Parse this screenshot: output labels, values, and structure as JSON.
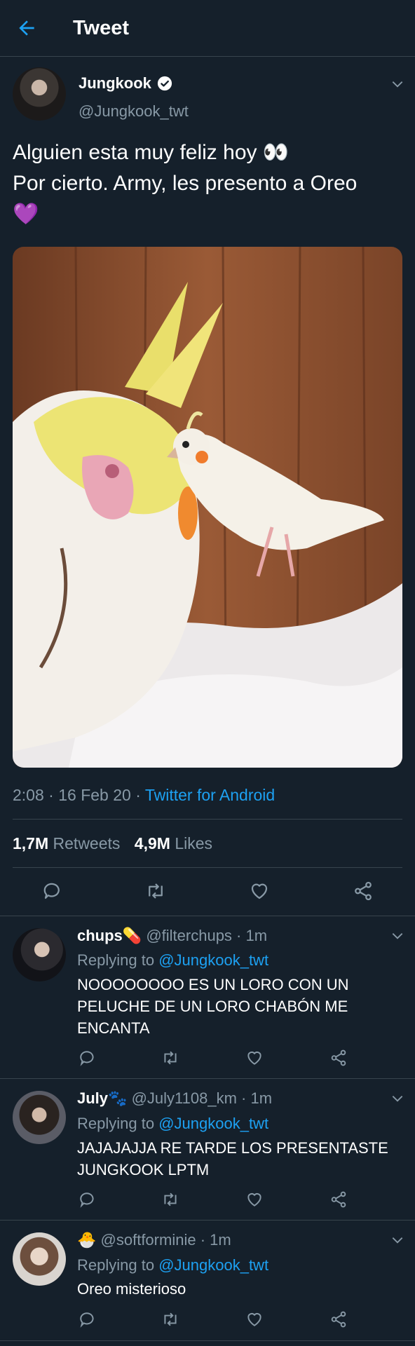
{
  "header": {
    "title": "Tweet"
  },
  "tweet": {
    "author_name": "Jungkook",
    "author_handle": "@Jungkook_twt",
    "text_line1": "Alguien esta muy feliz hoy 👀",
    "text_line2": "Por cierto. Army, les presento a Oreo",
    "text_line3": "💜",
    "time": "2:08",
    "date": "16 Feb 20",
    "source": "Twitter for Android",
    "retweets_count": "1,7M",
    "retweets_label": "Retweets",
    "likes_count": "4,9M",
    "likes_label": "Likes"
  },
  "replies": [
    {
      "name": "chups",
      "emoji": "💊",
      "handle": "@filterchups",
      "time": "1m",
      "replying_label": "Replying to",
      "replying_to": "@Jungkook_twt",
      "text_line1": "NOOOOOOOO ES UN LORO CON UN",
      "text_line2": "PELUCHE DE UN LORO CHABÓN ME",
      "text_line3": "ENCANTA"
    },
    {
      "name": "July",
      "emoji": "🐾",
      "handle": "@July1108_km",
      "time": "1m",
      "replying_label": "Replying to",
      "replying_to": "@Jungkook_twt",
      "text_line1": "JAJAJAJJA RE TARDE LOS PRESENTASTE",
      "text_line2": "JUNGKOOK LPTM"
    },
    {
      "name": "",
      "emoji": "🐣",
      "handle": "@softforminie",
      "time": "1m",
      "replying_label": "Replying to",
      "replying_to": "@Jungkook_twt",
      "text_line1": "Oreo misterioso"
    }
  ],
  "colors": {
    "background": "#15202b",
    "divider": "#38444d",
    "muted": "#8899a6",
    "accent": "#1da1f2"
  },
  "icons": [
    "back-arrow-icon",
    "verified-icon",
    "chevron-down-icon",
    "reply-icon",
    "retweet-icon",
    "like-icon",
    "share-icon"
  ]
}
